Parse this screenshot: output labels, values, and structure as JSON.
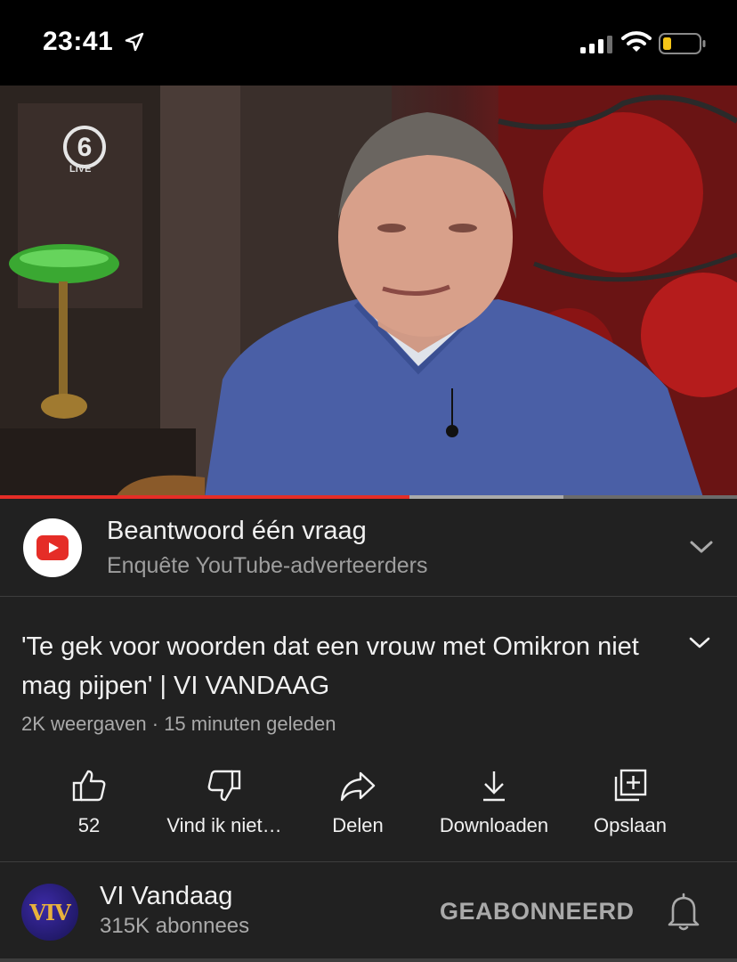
{
  "status_bar": {
    "time": "23:41",
    "icons": [
      "location-arrow-icon",
      "cellular-signal-icon",
      "wifi-icon",
      "battery-low-icon"
    ],
    "battery_color": "#f5c518"
  },
  "video": {
    "channel_logo_text": "6",
    "live_label": "LIVE",
    "progress_fraction": 0.555,
    "buffer_fraction": 0.765,
    "progress_color": "#e52d27"
  },
  "ad": {
    "title": "Beantwoord één vraag",
    "subtitle": "Enquête YouTube-adverteerders",
    "icon": "youtube-logo-icon"
  },
  "video_info": {
    "title": "'Te gek voor woorden dat een vrouw met Omikron niet mag pijpen' | VI VANDAAG",
    "meta": "2K weergaven · 15 minuten geleden"
  },
  "actions": [
    {
      "label": "52",
      "icon": "thumbs-up-icon"
    },
    {
      "label": "Vind ik niet…",
      "icon": "thumbs-down-icon"
    },
    {
      "label": "Delen",
      "icon": "share-icon"
    },
    {
      "label": "Downloaden",
      "icon": "download-icon"
    },
    {
      "label": "Opslaan",
      "icon": "save-playlist-icon"
    }
  ],
  "channel": {
    "avatar_text": "VIV",
    "name": "VI Vandaag",
    "subscribers": "315K abonnees",
    "subscribed_label": "GEABONNEERD"
  }
}
